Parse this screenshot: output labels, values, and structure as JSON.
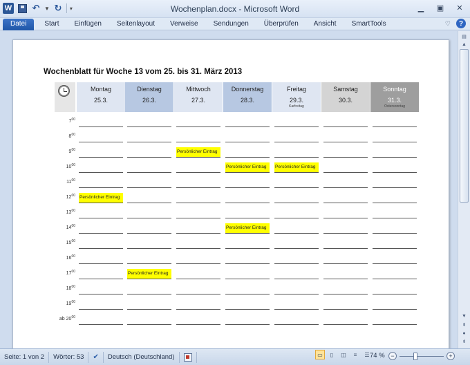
{
  "window": {
    "title": "Wochenplan.docx - Microsoft Word"
  },
  "ribbon": {
    "tabs": [
      "Datei",
      "Start",
      "Einfügen",
      "Seitenlayout",
      "Verweise",
      "Sendungen",
      "Überprüfen",
      "Ansicht",
      "SmartTools"
    ]
  },
  "document": {
    "title": "Wochenblatt für Woche 13 vom 25. bis 31. März 2013",
    "days": [
      {
        "name": "Montag",
        "date": "25.3.",
        "holiday": "",
        "bg": "#dfe6f2",
        "color": "#222222"
      },
      {
        "name": "Dienstag",
        "date": "26.3.",
        "holiday": "",
        "bg": "#b7c8e2",
        "color": "#222222"
      },
      {
        "name": "Mittwoch",
        "date": "27.3.",
        "holiday": "",
        "bg": "#dfe6f2",
        "color": "#222222"
      },
      {
        "name": "Donnerstag",
        "date": "28.3.",
        "holiday": "",
        "bg": "#b7c8e2",
        "color": "#222222"
      },
      {
        "name": "Freitag",
        "date": "29.3.",
        "holiday": "Karfreitag",
        "bg": "#dfe6f2",
        "color": "#222222"
      },
      {
        "name": "Samstag",
        "date": "30.3.",
        "holiday": "",
        "bg": "#d4d4d4",
        "color": "#222222"
      },
      {
        "name": "Sonntag",
        "date": "31.3.",
        "holiday": "Ostersonntag",
        "bg": "#9e9e9e",
        "color": "#ffffff"
      }
    ],
    "hours": [
      {
        "prefix": "",
        "h": "7",
        "sup": "00"
      },
      {
        "prefix": "",
        "h": "8",
        "sup": "00"
      },
      {
        "prefix": "",
        "h": "9",
        "sup": "00"
      },
      {
        "prefix": "",
        "h": "10",
        "sup": "00"
      },
      {
        "prefix": "",
        "h": "11",
        "sup": "00"
      },
      {
        "prefix": "",
        "h": "12",
        "sup": "00"
      },
      {
        "prefix": "",
        "h": "13",
        "sup": "00"
      },
      {
        "prefix": "",
        "h": "14",
        "sup": "00"
      },
      {
        "prefix": "",
        "h": "15",
        "sup": "00"
      },
      {
        "prefix": "",
        "h": "16",
        "sup": "00"
      },
      {
        "prefix": "",
        "h": "17",
        "sup": "00"
      },
      {
        "prefix": "",
        "h": "18",
        "sup": "00"
      },
      {
        "prefix": "",
        "h": "19",
        "sup": "00"
      },
      {
        "prefix": "ab ",
        "h": "20",
        "sup": "00"
      }
    ],
    "entries": [
      {
        "day": 0,
        "hour": 5,
        "text": "Persönlicher Eintrag"
      },
      {
        "day": 1,
        "hour": 10,
        "text": "Persönlicher Eintrag"
      },
      {
        "day": 2,
        "hour": 2,
        "text": "Persönlicher Eintrag"
      },
      {
        "day": 3,
        "hour": 3,
        "text": "Persönlicher Eintrag"
      },
      {
        "day": 3,
        "hour": 7,
        "text": "Persönlicher Eintrag"
      },
      {
        "day": 4,
        "hour": 3,
        "text": "Persönlicher Eintrag"
      }
    ],
    "highlight_color": "#ffff00"
  },
  "status": {
    "page": "Seite: 1 von 2",
    "words": "Wörter: 53",
    "language": "Deutsch (Deutschland)",
    "zoom": "74 %",
    "zoom_value": 74
  }
}
